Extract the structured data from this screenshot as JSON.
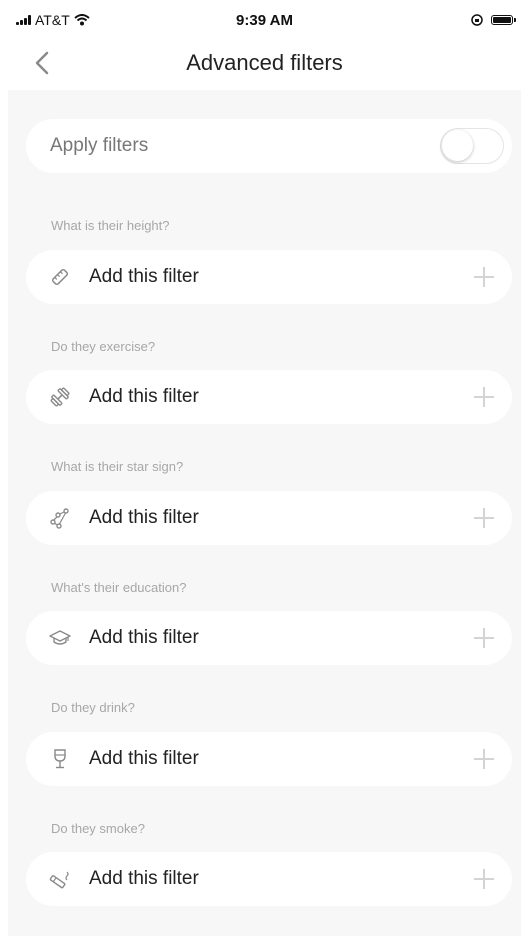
{
  "status": {
    "carrier": "AT&T",
    "time": "9:39 AM"
  },
  "nav": {
    "title": "Advanced filters"
  },
  "apply": {
    "label": "Apply filters",
    "enabled": false
  },
  "filters": [
    {
      "question": "What is their height?",
      "action": "Add this filter",
      "icon": "ruler-icon"
    },
    {
      "question": "Do they exercise?",
      "action": "Add this filter",
      "icon": "dumbbell-icon"
    },
    {
      "question": "What is their star sign?",
      "action": "Add this filter",
      "icon": "star-sign-icon"
    },
    {
      "question": "What's their education?",
      "action": "Add this filter",
      "icon": "graduation-cap-icon"
    },
    {
      "question": "Do they drink?",
      "action": "Add this filter",
      "icon": "wine-glass-icon"
    },
    {
      "question": "Do they smoke?",
      "action": "Add this filter",
      "icon": "cigarette-icon"
    }
  ]
}
